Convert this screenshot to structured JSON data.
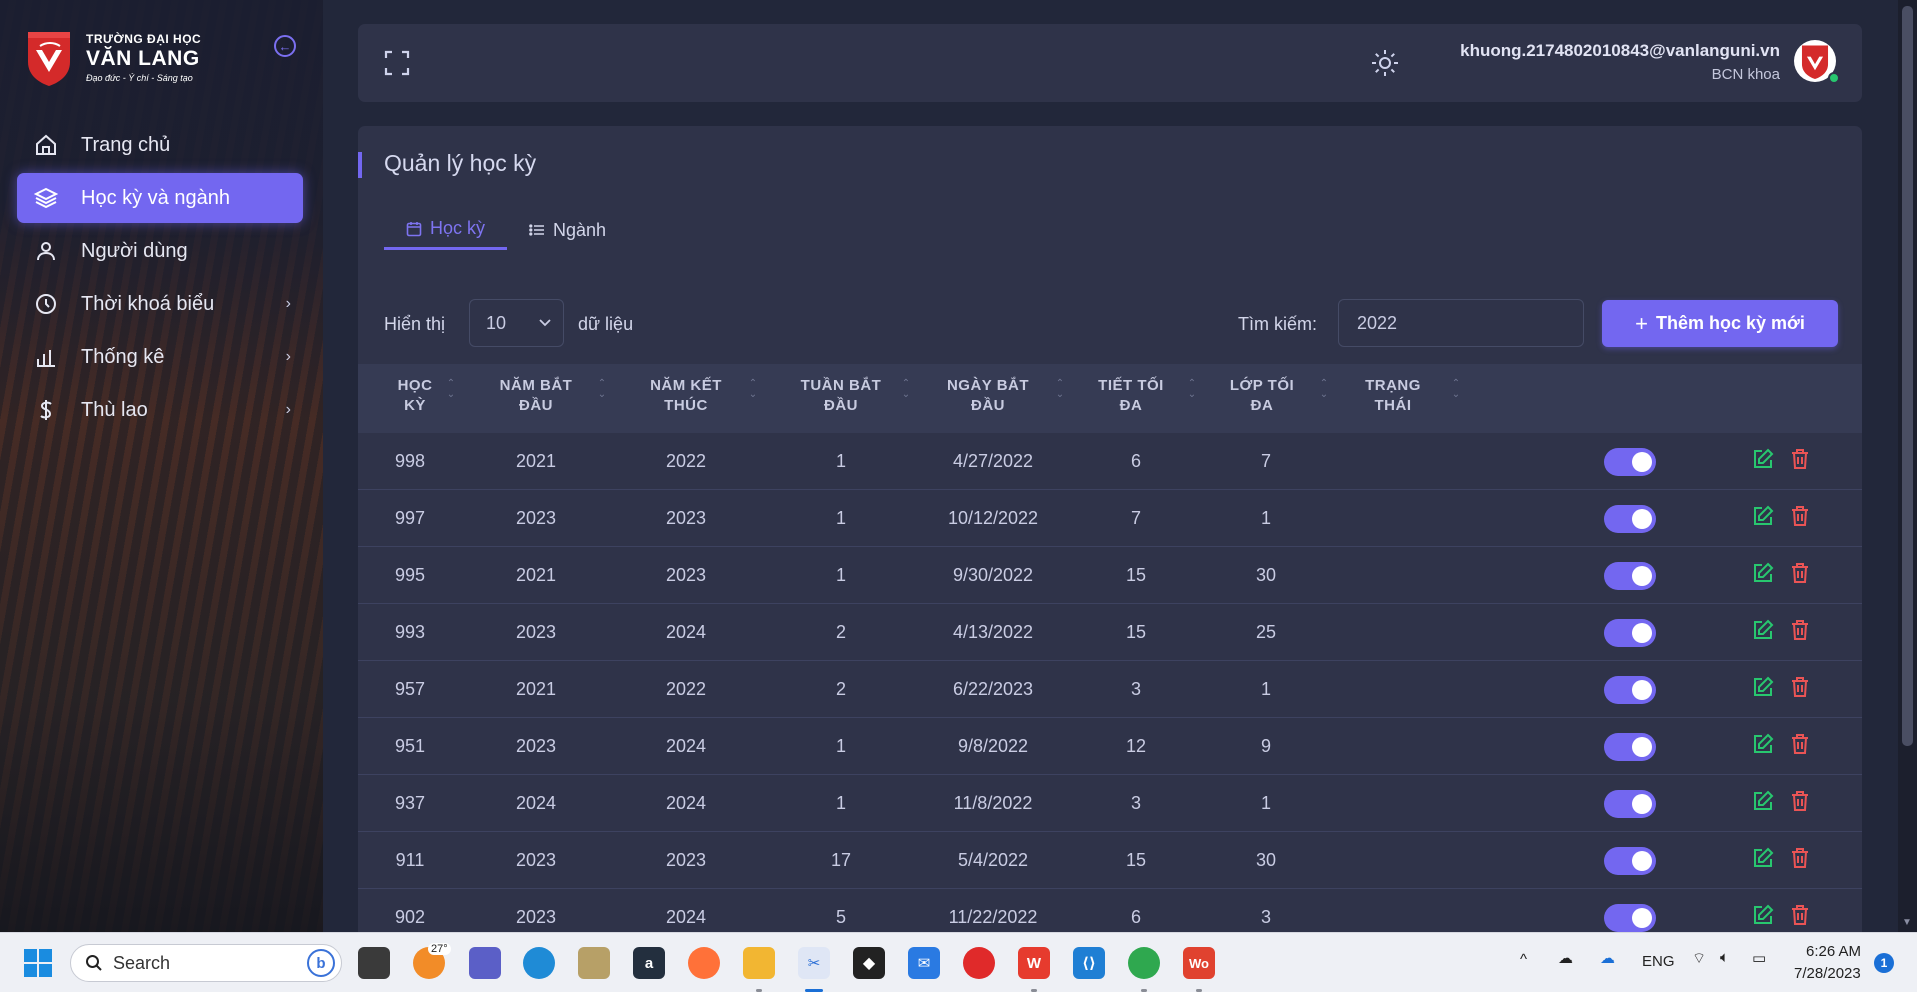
{
  "brand": {
    "line1": "TRƯỜNG ĐẠI HỌC",
    "line2": "VĂN LANG",
    "motto": "Đạo đức - Ý chí - Sáng tạo"
  },
  "sidebar": {
    "items": [
      {
        "label": "Trang chủ",
        "icon": "home-icon"
      },
      {
        "label": "Học kỳ và ngành",
        "icon": "layers-icon",
        "active": true
      },
      {
        "label": "Người dùng",
        "icon": "user-icon"
      },
      {
        "label": "Thời khoá biểu",
        "icon": "clock-icon",
        "submenu": true
      },
      {
        "label": "Thống kê",
        "icon": "bar-chart-icon",
        "submenu": true
      },
      {
        "label": "Thù lao",
        "icon": "dollar-icon",
        "submenu": true
      }
    ]
  },
  "header": {
    "email": "khuong.2174802010843@vanlanguni.vn",
    "role": "BCN khoa"
  },
  "page": {
    "title": "Quản lý học kỳ",
    "tabs": [
      {
        "label": "Học kỳ",
        "active": true
      },
      {
        "label": "Ngành",
        "active": false
      }
    ],
    "show_label": "Hiển thị",
    "page_size": "10",
    "data_label": "dữ liệu",
    "search_label": "Tìm kiếm:",
    "search_value": "2022",
    "add_button": "Thêm học kỳ mới"
  },
  "table": {
    "columns": [
      {
        "l1": "HỌC",
        "l2": "KỲ"
      },
      {
        "l1": "NĂM BẮT",
        "l2": "ĐẦU"
      },
      {
        "l1": "NĂM KẾT",
        "l2": "THÚC"
      },
      {
        "l1": "TUẦN BẮT",
        "l2": "ĐẦU"
      },
      {
        "l1": "NGÀY BẮT",
        "l2": "ĐẦU"
      },
      {
        "l1": "TIẾT TỐI",
        "l2": "ĐA"
      },
      {
        "l1": "LỚP TỐI",
        "l2": "ĐA"
      },
      {
        "l1": "TRẠNG",
        "l2": "THÁI"
      }
    ],
    "rows": [
      {
        "term": "998",
        "start_year": "2021",
        "end_year": "2022",
        "start_week": "1",
        "start_date": "4/27/2022",
        "max_periods": "6",
        "max_classes": "7",
        "status": true
      },
      {
        "term": "997",
        "start_year": "2023",
        "end_year": "2023",
        "start_week": "1",
        "start_date": "10/12/2022",
        "max_periods": "7",
        "max_classes": "1",
        "status": true
      },
      {
        "term": "995",
        "start_year": "2021",
        "end_year": "2023",
        "start_week": "1",
        "start_date": "9/30/2022",
        "max_periods": "15",
        "max_classes": "30",
        "status": true
      },
      {
        "term": "993",
        "start_year": "2023",
        "end_year": "2024",
        "start_week": "2",
        "start_date": "4/13/2022",
        "max_periods": "15",
        "max_classes": "25",
        "status": true
      },
      {
        "term": "957",
        "start_year": "2021",
        "end_year": "2022",
        "start_week": "2",
        "start_date": "6/22/2023",
        "max_periods": "3",
        "max_classes": "1",
        "status": true
      },
      {
        "term": "951",
        "start_year": "2023",
        "end_year": "2024",
        "start_week": "1",
        "start_date": "9/8/2022",
        "max_periods": "12",
        "max_classes": "9",
        "status": true
      },
      {
        "term": "937",
        "start_year": "2024",
        "end_year": "2024",
        "start_week": "1",
        "start_date": "11/8/2022",
        "max_periods": "3",
        "max_classes": "1",
        "status": true
      },
      {
        "term": "911",
        "start_year": "2023",
        "end_year": "2023",
        "start_week": "17",
        "start_date": "5/4/2022",
        "max_periods": "15",
        "max_classes": "30",
        "status": true
      },
      {
        "term": "902",
        "start_year": "2023",
        "end_year": "2024",
        "start_week": "5",
        "start_date": "11/22/2022",
        "max_periods": "6",
        "max_classes": "3",
        "status": true
      }
    ]
  },
  "taskbar": {
    "search_placeholder": "Search",
    "weather_temp": "27°",
    "language": "ENG",
    "time": "6:26 AM",
    "date": "7/28/2023",
    "notifications": "1"
  },
  "colors": {
    "accent": "#7367f0",
    "card": "#2f3349",
    "background": "#22273a",
    "edit": "#28c76f",
    "delete": "#ea5455"
  }
}
